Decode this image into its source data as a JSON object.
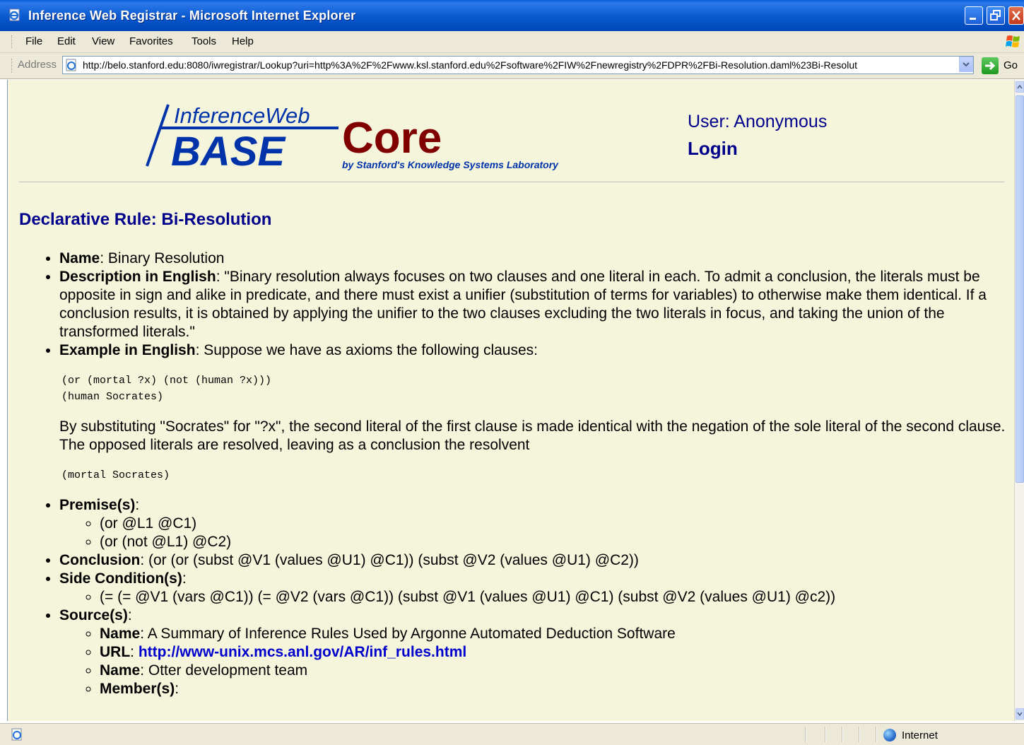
{
  "window": {
    "title": "Inference Web Registrar - Microsoft Internet Explorer"
  },
  "menu": {
    "items": [
      "File",
      "Edit",
      "View",
      "Favorites",
      "Tools",
      "Help"
    ]
  },
  "address": {
    "label": "Address",
    "url": "http://belo.stanford.edu:8080/iwregistrar/Lookup?uri=http%3A%2F%2Fwww.ksl.stanford.edu%2Fsoftware%2FIW%2Fnewregistry%2FDPR%2FBi-Resolution.daml%23Bi-Resolut",
    "go_label": "Go"
  },
  "status": {
    "zone": "Internet"
  },
  "page": {
    "logo": {
      "inference_web": "InferenceWeb",
      "base": "BASE",
      "core": "Core",
      "byline": "by Stanford's Knowledge Systems Laboratory"
    },
    "user": "User: Anonymous",
    "login": "Login",
    "heading": "Declarative Rule: Bi-Resolution",
    "name_label": "Name",
    "name_value": ": Binary Resolution",
    "desc_label": "Description in English",
    "desc_value": ": \"Binary resolution always focuses on two clauses and one literal in each. To admit a conclusion, the literals must be opposite in sign and alike in predicate, and there must exist a unifier (substitution of terms for variables) to otherwise make them identical. If a conclusion results, it is obtained by applying the unifier to the two clauses excluding the two literals in focus, and taking the union of the transformed literals.\"",
    "example_label": "Example in English",
    "example_value": ": Suppose we have as axioms the following clauses:",
    "example_code": "(or (mortal ?x) (not (human ?x)))\n(human Socrates)",
    "example_text": "By substituting \"Socrates\" for \"?x\", the second literal of the first clause is made identical with the negation of the sole literal of the second clause. The opposed literals are resolved, leaving as a conclusion the resolvent",
    "example_code2": "(mortal Socrates)",
    "premises_label": "Premise(s)",
    "premises_colon": ":",
    "premises": [
      "(or @L1 @C1)",
      "(or (not @L1) @C2)"
    ],
    "conclusion_label": "Conclusion",
    "conclusion_value": ": (or (or (subst @V1 (values @U1) @C1)) (subst @V2 (values @U1) @C2))",
    "side_label": "Side Condition(s)",
    "side_colon": ":",
    "side_conditions": [
      "(= (= @V1 (vars @C1)) (= @V2 (vars @C1)) (subst @V1 (values @U1) @C1) (subst @V2 (values @U1) @c2))"
    ],
    "sources_label": "Source(s)",
    "sources_colon": ":",
    "source1_name_label": "Name",
    "source1_name_value": ": A Summary of Inference Rules Used by Argonne Automated Deduction Software",
    "source1_url_label": "URL",
    "source1_url_colon": ": ",
    "source1_url": "http://www-unix.mcs.anl.gov/AR/inf_rules.html",
    "source2_name_label": "Name",
    "source2_name_value": ": Otter development team",
    "source2_members_label": "Member(s)",
    "source2_members_colon": ":"
  },
  "colors": {
    "page_background": "#f5f5dc",
    "heading": "#00008b",
    "link": "#0000cc",
    "logo_blue": "#0033aa",
    "logo_red": "#800000"
  }
}
